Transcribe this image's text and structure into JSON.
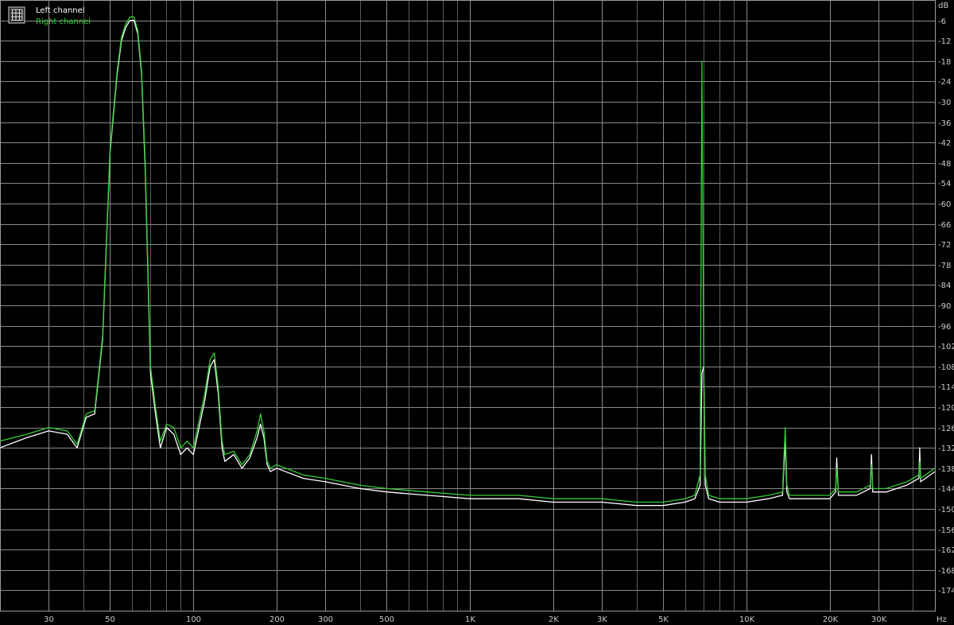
{
  "chart_data": {
    "type": "line",
    "title": "",
    "xlabel": "",
    "ylabel": "",
    "x_unit": "Hz",
    "y_unit": "dB",
    "x_scale": "log",
    "xlim": [
      20,
      48000
    ],
    "ylim": [
      -180,
      0
    ],
    "grid": true,
    "legend_position": "top-left",
    "x_ticks": [
      {
        "value": 30,
        "label": "30"
      },
      {
        "value": 50,
        "label": "50"
      },
      {
        "value": 100,
        "label": "100"
      },
      {
        "value": 200,
        "label": "200"
      },
      {
        "value": 300,
        "label": "300"
      },
      {
        "value": 500,
        "label": "500"
      },
      {
        "value": 1000,
        "label": "1K"
      },
      {
        "value": 2000,
        "label": "2K"
      },
      {
        "value": 3000,
        "label": "3K"
      },
      {
        "value": 5000,
        "label": "5K"
      },
      {
        "value": 10000,
        "label": "10K"
      },
      {
        "value": 20000,
        "label": "20K"
      },
      {
        "value": 30000,
        "label": "30K"
      }
    ],
    "x_minor_ticks": [
      40,
      60,
      70,
      80,
      90,
      400,
      600,
      700,
      800,
      900,
      4000,
      6000,
      7000,
      8000,
      9000,
      40000
    ],
    "y_ticks": [
      -6,
      -12,
      -18,
      -24,
      -30,
      -36,
      -42,
      -48,
      -54,
      -60,
      -66,
      -72,
      -78,
      -84,
      -90,
      -96,
      -102,
      -108,
      -114,
      -120,
      -126,
      -132,
      -138,
      -144,
      -150,
      -156,
      -162,
      -168,
      -174
    ],
    "series": [
      {
        "name": "Left channel",
        "color": "#ffffff",
        "x": [
          20,
          25,
          30,
          35,
          38,
          41,
          44,
          47,
          50,
          53,
          55,
          57,
          59,
          61,
          63,
          65,
          67,
          70,
          73,
          76,
          80,
          85,
          90,
          95,
          100,
          110,
          115,
          119,
          123,
          127,
          130,
          140,
          150,
          160,
          170,
          175,
          180,
          185,
          190,
          200,
          250,
          300,
          400,
          500,
          700,
          1000,
          1500,
          2000,
          3000,
          4000,
          5000,
          6000,
          6500,
          6800,
          6900,
          7000,
          7100,
          7300,
          8000,
          10000,
          12000,
          13500,
          13800,
          14000,
          14300,
          16000,
          20000,
          21000,
          21200,
          21500,
          25000,
          28000,
          28300,
          28600,
          32000,
          38000,
          42000,
          42300,
          42600,
          48000
        ],
        "y": [
          -132,
          -129,
          -127,
          -128,
          -132,
          -123,
          -122,
          -100,
          -45,
          -22,
          -12,
          -8,
          -6,
          -6,
          -10,
          -22,
          -50,
          -110,
          -122,
          -132,
          -126,
          -128,
          -134,
          -132,
          -134,
          -118,
          -108,
          -106,
          -116,
          -132,
          -136,
          -134,
          -138,
          -135,
          -129,
          -125,
          -129,
          -137,
          -139,
          -138,
          -141,
          -142,
          -144,
          -145,
          -146,
          -147,
          -147,
          -148,
          -148,
          -149,
          -149,
          -148,
          -147,
          -143,
          -110,
          -108,
          -143,
          -147,
          -148,
          -148,
          -147,
          -146,
          -130,
          -145,
          -147,
          -147,
          -147,
          -145,
          -135,
          -146,
          -146,
          -144,
          -134,
          -145,
          -145,
          -143,
          -141,
          -132,
          -142,
          -139
        ]
      },
      {
        "name": "Right channel",
        "color": "#33cc33",
        "x": [
          20,
          25,
          30,
          35,
          38,
          41,
          44,
          47,
          50,
          53,
          55,
          57,
          59,
          61,
          63,
          65,
          67,
          70,
          73,
          76,
          80,
          85,
          90,
          95,
          100,
          110,
          115,
          119,
          123,
          127,
          130,
          140,
          150,
          160,
          170,
          175,
          180,
          185,
          190,
          200,
          250,
          300,
          400,
          500,
          700,
          1000,
          1500,
          2000,
          3000,
          4000,
          5000,
          6000,
          6500,
          6800,
          6900,
          7000,
          7100,
          7300,
          8000,
          10000,
          12000,
          13500,
          13800,
          14000,
          14300,
          16000,
          20000,
          21000,
          21200,
          21500,
          25000,
          28000,
          28300,
          28600,
          32000,
          38000,
          42000,
          42300,
          42600,
          48000
        ],
        "y": [
          -130,
          -128,
          -126,
          -127,
          -131,
          -122,
          -121,
          -99,
          -44,
          -21,
          -11,
          -7,
          -5,
          -5,
          -9,
          -21,
          -48,
          -108,
          -120,
          -130,
          -125,
          -126,
          -132,
          -130,
          -132,
          -116,
          -106,
          -104,
          -114,
          -130,
          -134,
          -133,
          -137,
          -134,
          -127,
          -122,
          -127,
          -136,
          -138,
          -137,
          -140,
          -141,
          -143,
          -144,
          -145,
          -146,
          -146,
          -147,
          -147,
          -148,
          -148,
          -147,
          -146,
          -140,
          -18,
          -105,
          -140,
          -146,
          -147,
          -147,
          -146,
          -145,
          -126,
          -143,
          -146,
          -146,
          -146,
          -144,
          -138,
          -145,
          -145,
          -143,
          -137,
          -144,
          -144,
          -142,
          -140,
          -136,
          -141,
          -138
        ]
      }
    ]
  },
  "legend": {
    "icon": "grid-icon"
  }
}
